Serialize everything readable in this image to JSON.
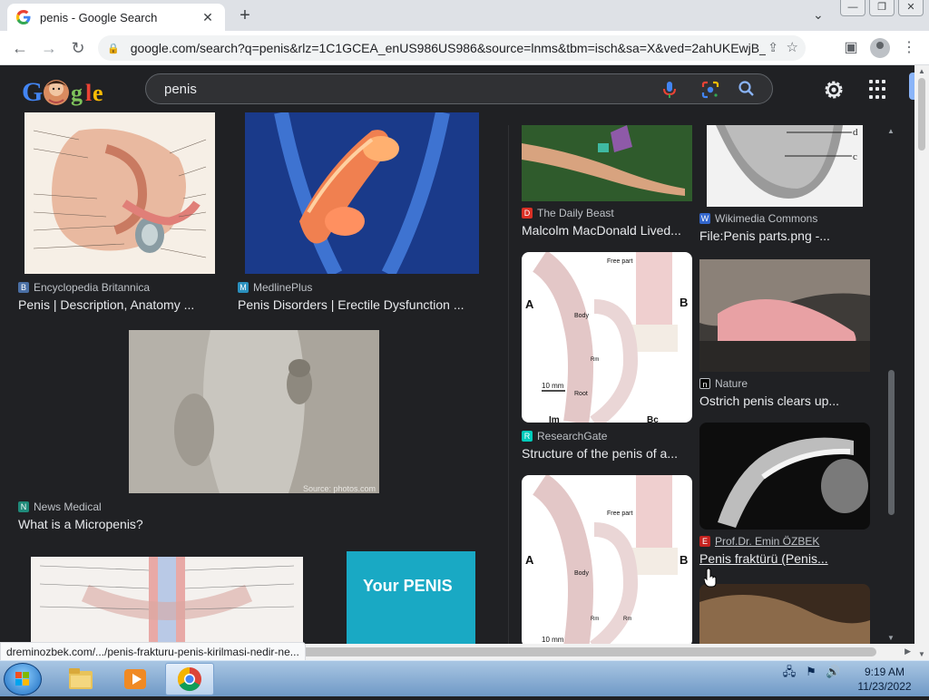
{
  "browser": {
    "tab": {
      "title": "penis - Google Search",
      "close": "✕"
    },
    "new_tab": "+",
    "tab_search": "⌄",
    "window_controls": {
      "minimize": "—",
      "maximize": "❐",
      "close": "✕"
    },
    "nav": {
      "back": "←",
      "forward": "→",
      "reload": "↻"
    },
    "address": "google.com/search?q=penis&rlz=1C1GCEA_enUS986US986&source=lnms&tbm=isch&sa=X&ved=2ahUKEwjB_t...",
    "share": "⇪",
    "bookmark": "☆",
    "side_panel": "▣",
    "menu": "⋮"
  },
  "google": {
    "search_query": "penis",
    "colors": {
      "bg": "#202124",
      "text": "#e8eaed",
      "secondary": "#bdc1c6",
      "accent": "#8ab4f8"
    }
  },
  "results": [
    {
      "source": "Encyclopedia Britannica",
      "title": "Penis | Description, Anatomy ...",
      "fav_color": "#4a6fa5",
      "fav_glyph": "B"
    },
    {
      "source": "MedlinePlus",
      "title": "Penis Disorders | Erectile Dysfunction ...",
      "fav_color": "#2a8fbd",
      "fav_glyph": "M"
    },
    {
      "source": "News Medical",
      "title": "What is a Micropenis?",
      "fav_color": "#1f8a7a",
      "fav_glyph": "N",
      "watermark": "Source: photos.com"
    },
    {
      "book_title": "Your PENIS"
    }
  ],
  "panel": [
    {
      "source": "The Daily Beast",
      "title": "Malcolm MacDonald Lived...",
      "fav_color": "#d93025",
      "fav_glyph": "D"
    },
    {
      "source": "Wikimedia Commons",
      "title": "File:Penis parts.png -...",
      "fav_color": "#3366cc",
      "fav_glyph": "W",
      "labels": [
        "d",
        "c"
      ]
    },
    {
      "source": "ResearchGate",
      "title": "Structure of the penis of a...",
      "fav_color": "#00ccbb",
      "fav_glyph": "R",
      "labels": [
        "A",
        "B",
        "Free part",
        "Body",
        "Root",
        "10 mm",
        "Im",
        "Rm",
        "Bc"
      ]
    },
    {
      "source": "Nature",
      "title": "Ostrich penis clears up...",
      "fav_color": "#000000",
      "fav_glyph": "n"
    },
    {
      "labels": [
        "A",
        "B",
        "Free part",
        "Body",
        "10 mm",
        "Rm",
        "Rm"
      ]
    },
    {
      "source": "Prof.Dr. Emin ÖZBEK",
      "title": "Penis fraktürü (Penis...",
      "fav_color": "#c5221f",
      "fav_glyph": "E"
    }
  ],
  "status_url": "dreminozbek.com/.../penis-frakturu-penis-kirilmasi-nedir-ne...",
  "taskbar": {
    "time": "9:19 AM",
    "date": "11/23/2022"
  }
}
